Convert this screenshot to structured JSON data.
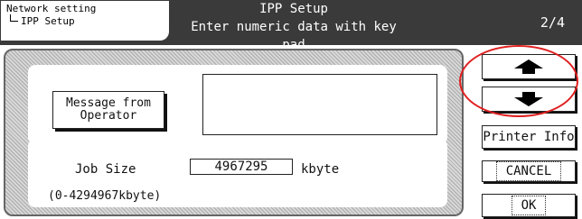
{
  "header": {
    "breadcrumb": [
      "Network setting",
      "IPP Setup"
    ],
    "title": "IPP Setup",
    "subtitle": "Enter numeric data with key pad",
    "page_indicator": "2/4"
  },
  "main": {
    "message_button_line1": "Message from",
    "message_button_line2": "Operator",
    "message_text": "",
    "job_size_label": "Job Size",
    "job_size_value": "4967295",
    "job_size_unit": "kbyte",
    "job_size_range": "(0-4294967kbyte)"
  },
  "side": {
    "up_icon": "up-arrow-icon",
    "down_icon": "down-arrow-icon",
    "printer_info": "Printer Info",
    "cancel": "CANCEL",
    "ok": "OK"
  },
  "colors": {
    "header_bg": "#3a3a3a",
    "annotation": "#e02020"
  }
}
